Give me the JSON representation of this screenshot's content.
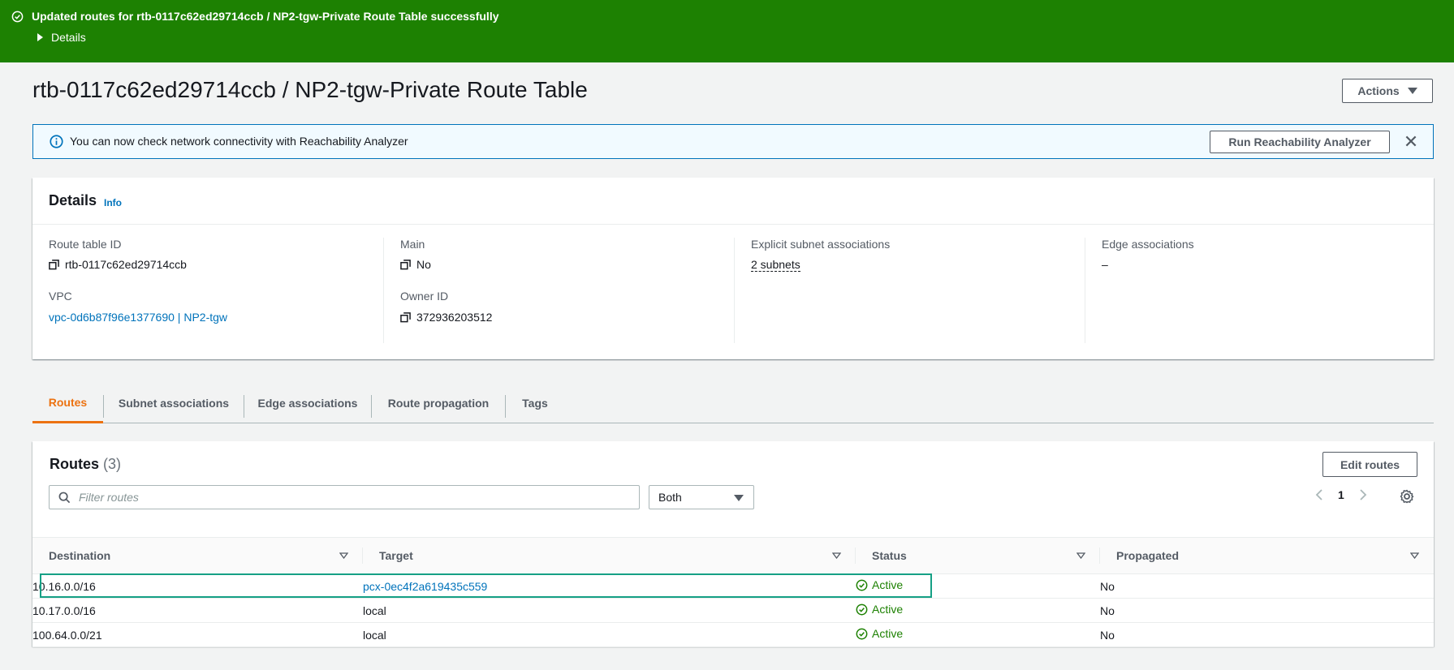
{
  "flash": {
    "message": "Updated routes for rtb-0117c62ed29714ccb / NP2-tgw-Private Route Table successfully",
    "details_label": "Details"
  },
  "header": {
    "title": "rtb-0117c62ed29714ccb / NP2-tgw-Private Route Table",
    "actions_label": "Actions"
  },
  "alert": {
    "text": "You can now check network connectivity with Reachability Analyzer",
    "button_label": "Run Reachability Analyzer"
  },
  "details": {
    "title": "Details",
    "info_label": "Info",
    "route_table_id_label": "Route table ID",
    "route_table_id": "rtb-0117c62ed29714ccb",
    "vpc_label": "VPC",
    "vpc": "vpc-0d6b87f96e1377690 | NP2-tgw",
    "main_label": "Main",
    "main": "No",
    "owner_id_label": "Owner ID",
    "owner_id": "372936203512",
    "explicit_label": "Explicit subnet associations",
    "explicit": "2 subnets",
    "edge_label": "Edge associations",
    "edge": "–"
  },
  "tabs": [
    {
      "label": "Routes",
      "active": true
    },
    {
      "label": "Subnet associations"
    },
    {
      "label": "Edge associations"
    },
    {
      "label": "Route propagation"
    },
    {
      "label": "Tags"
    }
  ],
  "routes": {
    "title": "Routes",
    "count": "(3)",
    "edit_label": "Edit routes",
    "filter_placeholder": "Filter routes",
    "select_value": "Both",
    "page": "1",
    "columns": [
      "Destination",
      "Target",
      "Status",
      "Propagated"
    ],
    "rows": [
      {
        "destination": "10.16.0.0/16",
        "target": "pcx-0ec4f2a619435c559",
        "target_link": true,
        "status": "Active",
        "propagated": "No"
      },
      {
        "destination": "10.17.0.0/16",
        "target": "local",
        "status": "Active",
        "propagated": "No"
      },
      {
        "destination": "100.64.0.0/21",
        "target": "local",
        "status": "Active",
        "propagated": "No"
      }
    ]
  },
  "colors": {
    "success_green": "#1d8102",
    "link_blue": "#0073bb",
    "active_tab_orange": "#ec7211",
    "highlight_teal": "#16a085"
  }
}
